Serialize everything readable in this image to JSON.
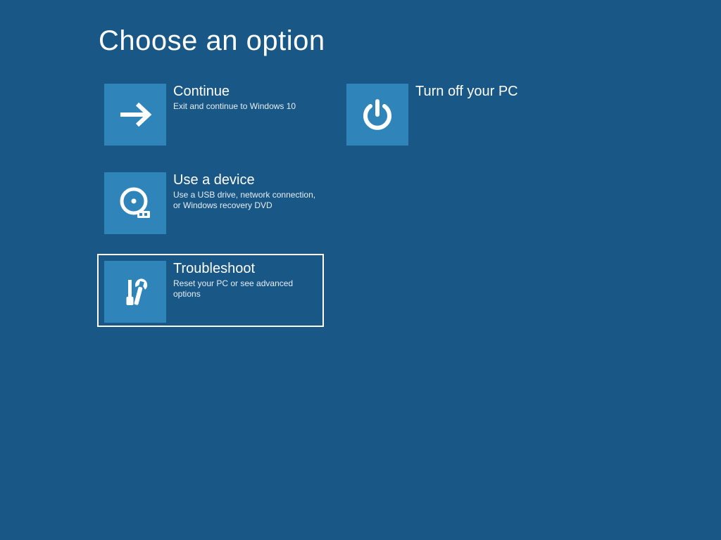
{
  "colors": {
    "background": "#195786",
    "tile_icon_bg": "#2f85ba",
    "text": "#ffffff"
  },
  "title": "Choose an option",
  "options": {
    "continue": {
      "title": "Continue",
      "desc": "Exit and continue to Windows 10",
      "selected": false
    },
    "use_device": {
      "title": "Use a device",
      "desc": "Use a USB drive, network connection, or Windows recovery DVD",
      "selected": false
    },
    "troubleshoot": {
      "title": "Troubleshoot",
      "desc": "Reset your PC or see advanced options",
      "selected": true
    },
    "turn_off": {
      "title": "Turn off your PC",
      "desc": "",
      "selected": false
    }
  }
}
